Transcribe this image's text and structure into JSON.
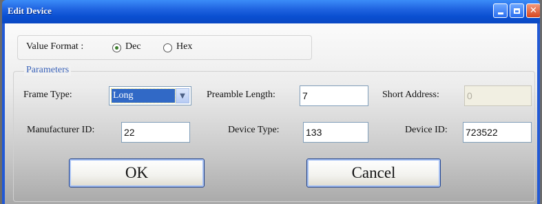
{
  "window": {
    "title": "Edit Device"
  },
  "title_buttons": {
    "min_icon": "minimize-icon",
    "max_icon": "maximize-icon",
    "close_icon": "close-icon"
  },
  "value_format": {
    "label": "Value Format :",
    "options": [
      {
        "label": "Dec",
        "selected": true
      },
      {
        "label": "Hex",
        "selected": false
      }
    ]
  },
  "parameters": {
    "legend": "Parameters",
    "frame_type_label": "Frame Type:",
    "frame_type_value": "Long",
    "preamble_length_label": "Preamble Length:",
    "preamble_length_value": "7",
    "short_address_label": "Short Address:",
    "short_address_value": "0",
    "manufacturer_id_label": "Manufacturer ID:",
    "manufacturer_id_value": "22",
    "device_type_label": "Device Type:",
    "device_type_value": "133",
    "device_id_label": "Device ID:",
    "device_id_value": "723522"
  },
  "buttons": {
    "ok": "OK",
    "cancel": "Cancel"
  },
  "colors": {
    "title_bar": "#0b4fd1",
    "close_button": "#d9461f",
    "selection": "#3169c6",
    "legend_text": "#3b63b8"
  }
}
